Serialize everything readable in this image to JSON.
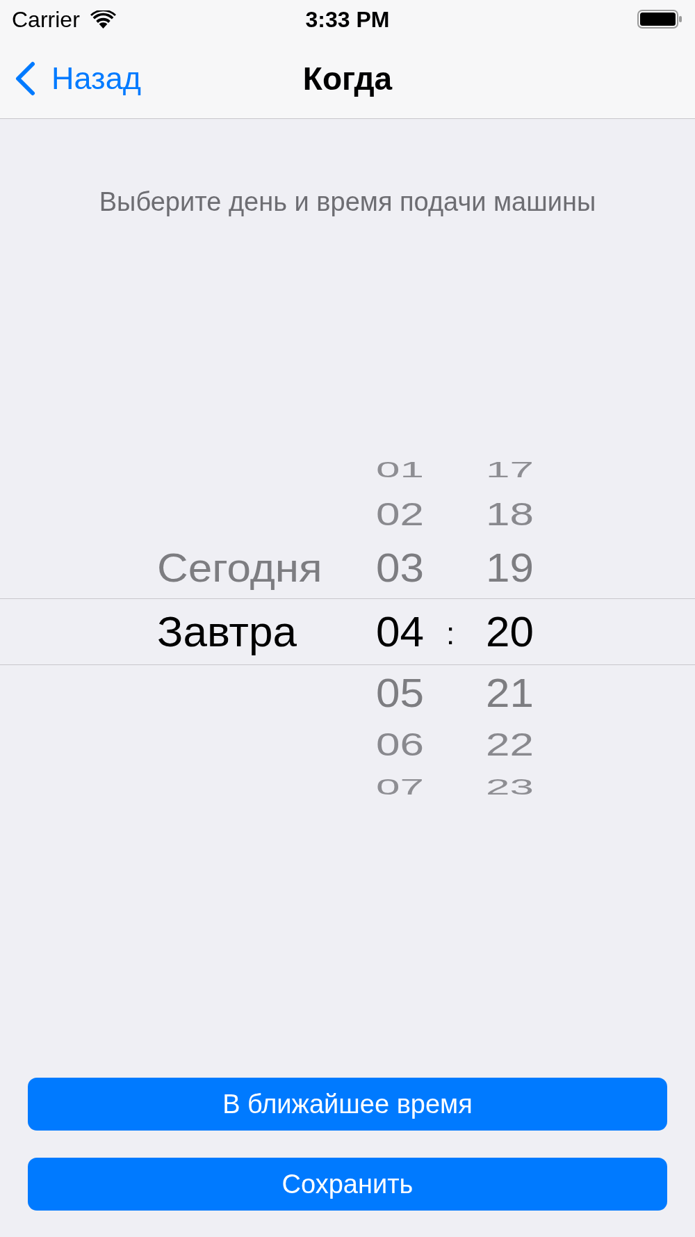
{
  "status_bar": {
    "carrier": "Carrier",
    "time": "3:33 PM"
  },
  "nav_bar": {
    "back_label": "Назад",
    "title": "Когда"
  },
  "hint": "Выберите день и время подачи машины",
  "picker": {
    "separator": ":",
    "columns": [
      {
        "kind": "day",
        "items": [
          {
            "label": "Сегодня",
            "selected": false
          },
          {
            "label": "Завтра",
            "selected": true
          }
        ]
      },
      {
        "kind": "hour",
        "items": [
          {
            "label": "01",
            "selected": false
          },
          {
            "label": "02",
            "selected": false
          },
          {
            "label": "03",
            "selected": false
          },
          {
            "label": "04",
            "selected": true
          },
          {
            "label": "05",
            "selected": false
          },
          {
            "label": "06",
            "selected": false
          },
          {
            "label": "07",
            "selected": false
          }
        ]
      },
      {
        "kind": "minute",
        "items": [
          {
            "label": "17",
            "selected": false
          },
          {
            "label": "18",
            "selected": false
          },
          {
            "label": "19",
            "selected": false
          },
          {
            "label": "20",
            "selected": true
          },
          {
            "label": "21",
            "selected": false
          },
          {
            "label": "22",
            "selected": false
          },
          {
            "label": "23",
            "selected": false
          }
        ]
      }
    ]
  },
  "buttons": [
    {
      "label": "В ближайшее время"
    },
    {
      "label": "Сохранить"
    }
  ]
}
